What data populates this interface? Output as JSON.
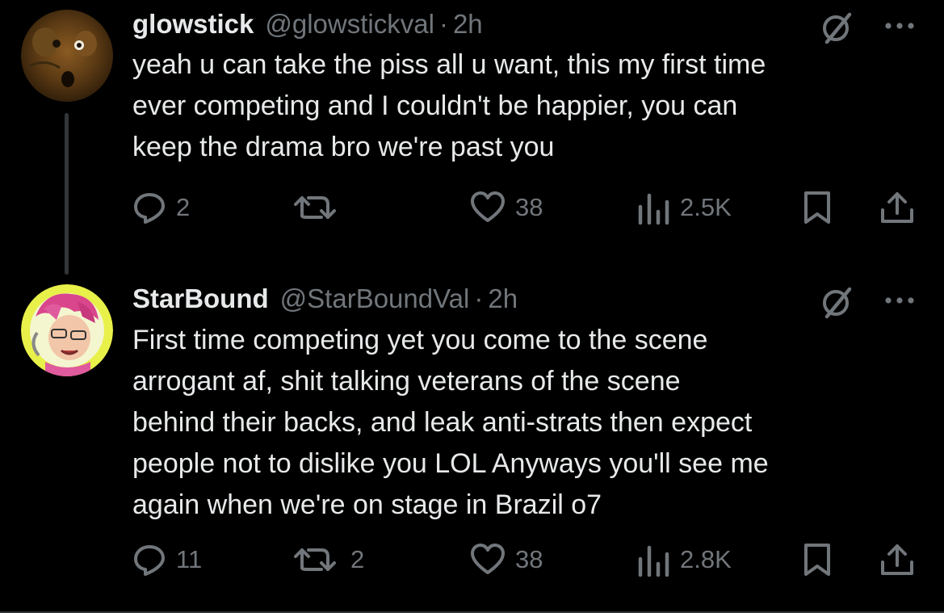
{
  "tweets": [
    {
      "display_name": "glowstick",
      "handle": "@glowstickval",
      "separator": "·",
      "time": "2h",
      "text": "yeah u can take the piss all u want, this my first time\never competing and I couldn't be happier, you can\nkeep the drama bro we're past you",
      "replies": "2",
      "reposts": "",
      "likes": "38",
      "views": "2.5K",
      "icons": [
        "grok-icon",
        "more-icon",
        "reply-icon",
        "repost-icon",
        "like-icon",
        "views-icon",
        "bookmark-icon",
        "share-icon"
      ]
    },
    {
      "display_name": "StarBound",
      "handle": "@StarBoundVal",
      "separator": "·",
      "time": "2h",
      "text": "First time competing yet you come to the scene\narrogant af, shit talking veterans of the scene\nbehind their backs, and leak anti-strats then expect\npeople not to dislike you LOL Anyways you'll see me\nagain when we're on stage in Brazil o7",
      "replies": "11",
      "reposts": "2",
      "likes": "38",
      "views": "2.8K",
      "icons": [
        "grok-icon",
        "more-icon",
        "reply-icon",
        "repost-icon",
        "like-icon",
        "views-icon",
        "bookmark-icon",
        "share-icon"
      ]
    }
  ],
  "colors": {
    "background": "#000000",
    "text": "#e7e9ea",
    "secondary": "#71767b",
    "thread_line": "#333639",
    "avatar2_ring": "#e8f04a"
  }
}
